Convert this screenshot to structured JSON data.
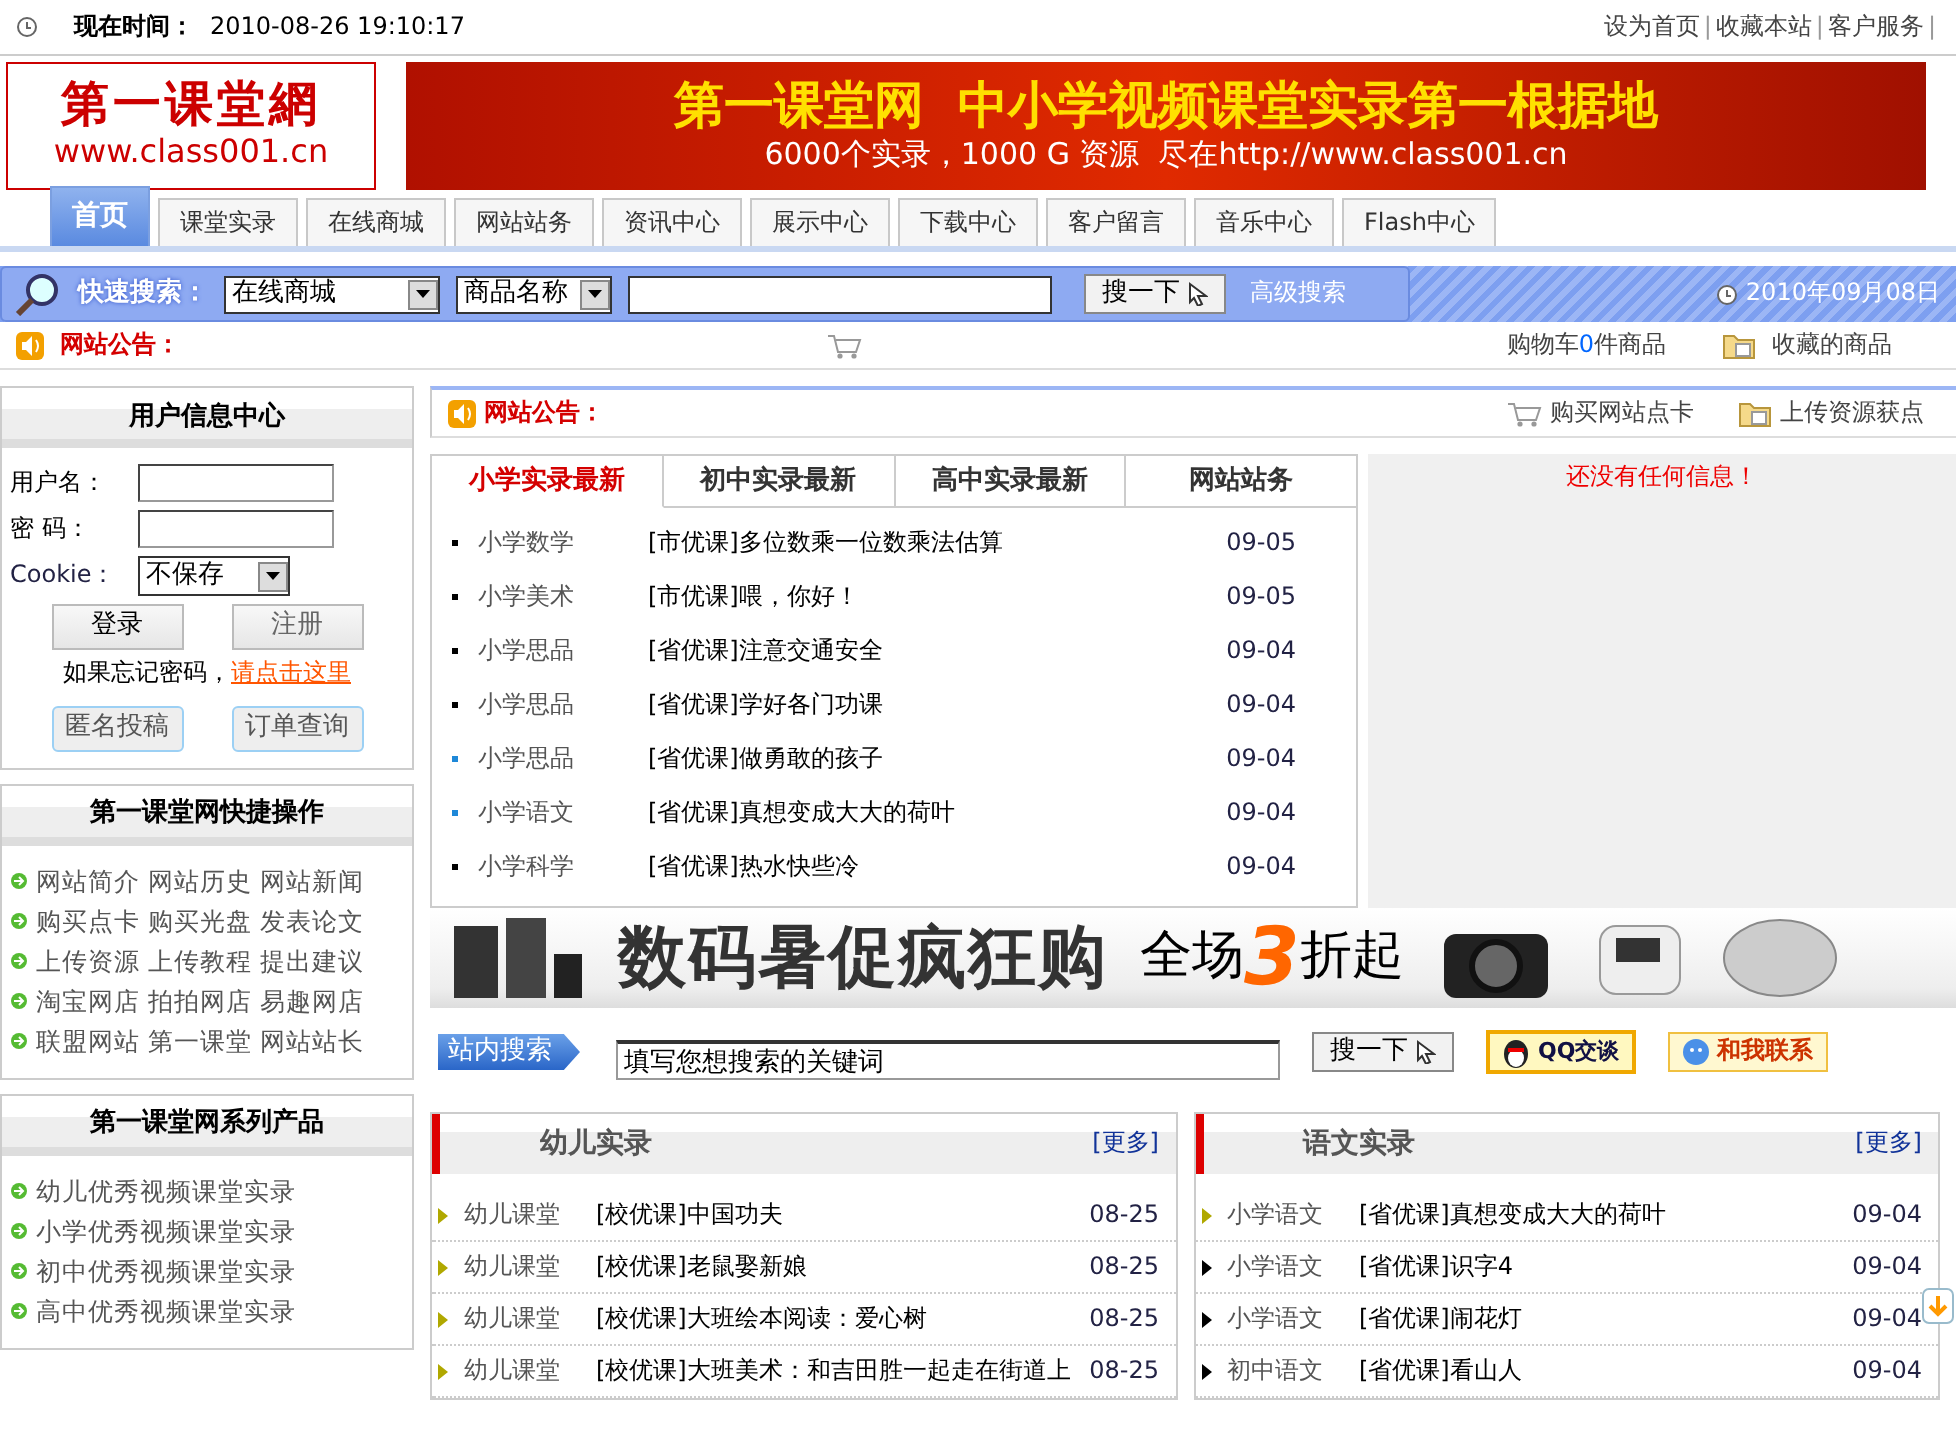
{
  "top_bar": {
    "time_label": "现在时间：",
    "time": "2010-08-26 19:10:17",
    "links": [
      "设为首页",
      "收藏本站",
      "客户服务"
    ],
    "separator": "|"
  },
  "header": {
    "logo_title": "第一课堂網",
    "logo_url": "www.class001.cn",
    "banner_title": "第一课堂网  中小学视频课堂实录第一根据地",
    "banner_subtitle": "6000个实录，1000 G 资源  尽在http://www.class001.cn"
  },
  "nav_tabs": [
    {
      "label": "首页",
      "selected": true
    },
    {
      "label": "课堂实录",
      "selected": false
    },
    {
      "label": "在线商城",
      "selected": false
    },
    {
      "label": "网站站务",
      "selected": false
    },
    {
      "label": "资讯中心",
      "selected": false
    },
    {
      "label": "展示中心",
      "selected": false
    },
    {
      "label": "下载中心",
      "selected": false
    },
    {
      "label": "客户留言",
      "selected": false
    },
    {
      "label": "音乐中心",
      "selected": false
    },
    {
      "label": "Flash中心",
      "selected": false
    }
  ],
  "quick_search": {
    "label": "快速搜索：",
    "category": "在线商城",
    "field": "商品名称",
    "button": "搜一下",
    "advanced": "高级搜索",
    "date": "2010年09月08日"
  },
  "notice_bar": {
    "label": "网站公告：",
    "cart_prefix": "购物车",
    "cart_count": "0",
    "cart_suffix": "件商品",
    "favorites": "收藏的商品"
  },
  "user_panel": {
    "title": "用户信息中心",
    "username_label": "用户名：",
    "password_label": "密 码：",
    "cookie_label": "Cookie：",
    "cookie_value": "不保存",
    "login": "登录",
    "register": "注册",
    "forgot_text": "如果忘记密码，",
    "forgot_link": "请点击这里",
    "anonymous": "匿名投稿",
    "order_query": "订单查询"
  },
  "quick_panel": {
    "title": "第一课堂网快捷操作",
    "rows": [
      [
        "网站简介",
        "网站历史",
        "网站新闻"
      ],
      [
        "购买点卡",
        "购买光盘",
        "发表论文"
      ],
      [
        "上传资源",
        "上传教程",
        "提出建议"
      ],
      [
        "淘宝网店",
        "拍拍网店",
        "易趣网店"
      ],
      [
        "联盟网站",
        "第一课堂",
        "网站站长"
      ]
    ]
  },
  "products_panel": {
    "title": "第一课堂网系列产品",
    "items": [
      "幼儿优秀视频课堂实录",
      "小学优秀视频课堂实录",
      "初中优秀视频课堂实录",
      "高中优秀视频课堂实录"
    ]
  },
  "main_notice": {
    "label": "网站公告：",
    "buy_card": "购买网站点卡",
    "upload": "上传资源获点"
  },
  "latest": {
    "tabs": [
      {
        "label": "小学实录最新",
        "selected": true
      },
      {
        "label": "初中实录最新",
        "selected": false
      },
      {
        "label": "高中实录最新",
        "selected": false
      },
      {
        "label": "网站站务",
        "selected": false
      }
    ],
    "rows": [
      {
        "category": "小学数学",
        "title": "[市优课]多位数乘一位数乘法估算",
        "date": "09-05",
        "color": "#000000"
      },
      {
        "category": "小学美术",
        "title": "[市优课]喂，你好！",
        "date": "09-05",
        "color": "#000000"
      },
      {
        "category": "小学思品",
        "title": "[省优课]注意交通安全",
        "date": "09-04",
        "color": "#000000"
      },
      {
        "category": "小学思品",
        "title": "[省优课]学好各门功课",
        "date": "09-04",
        "color": "#000000"
      },
      {
        "category": "小学思品",
        "title": "[省优课]做勇敢的孩子",
        "date": "09-04",
        "color": "#1e88d8"
      },
      {
        "category": "小学语文",
        "title": "[省优课]真想变成大大的荷叶",
        "date": "09-04",
        "color": "#1e88d8"
      },
      {
        "category": "小学科学",
        "title": "[省优课]热水快些冷",
        "date": "09-04",
        "color": "#000000"
      }
    ]
  },
  "info_panel": {
    "message": "还没有任何信息！"
  },
  "ad_banner": {
    "headline": "数码暑促疯狂购",
    "offer_prefix": "全场",
    "offer_number": "3",
    "offer_suffix": "折起"
  },
  "site_search": {
    "label": "站内搜索",
    "value": "填写您想搜索的关键词",
    "button": "搜一下",
    "qq": "QQ交谈",
    "contact": "和我联系"
  },
  "sections": [
    {
      "title": "幼儿实录",
      "more": "[更多]",
      "rows": [
        {
          "category": "幼儿课堂",
          "title": "[校优课]中国功夫",
          "date": "08-25",
          "color": "#b0a800"
        },
        {
          "category": "幼儿课堂",
          "title": "[校优课]老鼠娶新娘",
          "date": "08-25",
          "color": "#b0a800"
        },
        {
          "category": "幼儿课堂",
          "title": "[校优课]大班绘本阅读：爱心树",
          "date": "08-25",
          "color": "#b0a800"
        },
        {
          "category": "幼儿课堂",
          "title": "[校优课]大班美术：和吉田胜一起走在街道上",
          "date": "08-25",
          "color": "#b0a800"
        }
      ]
    },
    {
      "title": "语文实录",
      "more": "[更多]",
      "rows": [
        {
          "category": "小学语文",
          "title": "[省优课]真想变成大大的荷叶",
          "date": "09-04",
          "color": "#b0a800"
        },
        {
          "category": "小学语文",
          "title": "[省优课]识字4",
          "date": "09-04",
          "color": "#000000"
        },
        {
          "category": "小学语文",
          "title": "[省优课]闹花灯",
          "date": "09-04",
          "color": "#000000"
        },
        {
          "category": "初中语文",
          "title": "[省优课]看山人",
          "date": "09-04",
          "color": "#000000"
        }
      ]
    }
  ]
}
